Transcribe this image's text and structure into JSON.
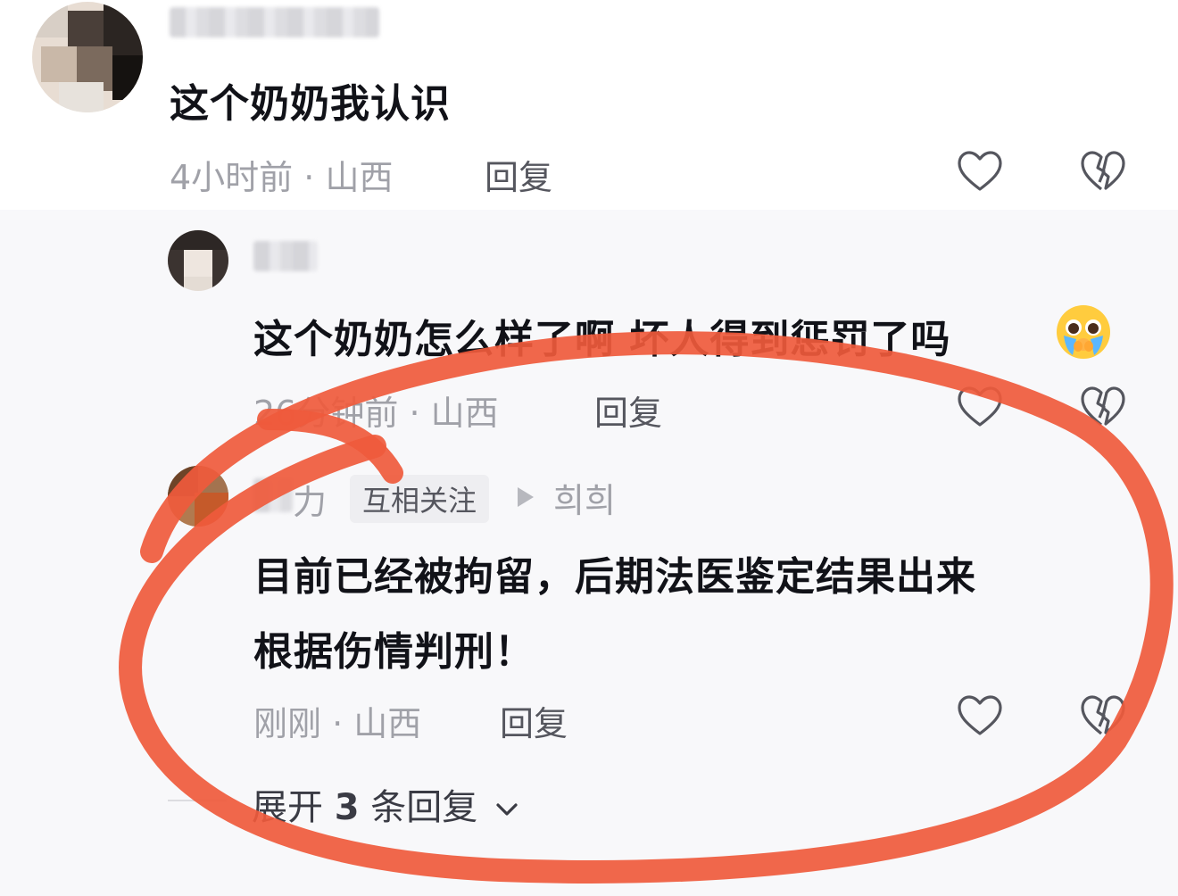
{
  "comments": [
    {
      "text": "这个奶奶我认识",
      "time": "4小时前",
      "location": "山西",
      "reply_label": "回复"
    },
    {
      "text": "这个奶奶怎么样了啊 坏人得到惩罚了吗",
      "emoji": "crying-face-emoji",
      "time": "26分钟前",
      "location": "山西",
      "reply_label": "回复"
    },
    {
      "username": "力",
      "follow_tag": "互相关注",
      "reply_to": "희희",
      "text_line1": "目前已经被拘留，后期法医鉴定结果出来",
      "text_line2": "根据伤情判刑！",
      "time": "刚刚",
      "location": "山西",
      "reply_label": "回复"
    }
  ],
  "expand": {
    "prefix": "展开",
    "count": "3",
    "suffix": "条回复"
  },
  "separator": "·",
  "icons": {
    "like": "heart-outline-icon",
    "dislike": "broken-heart-icon",
    "expand": "chevron-down-icon"
  },
  "colors": {
    "annotation_circle": "#ef5a3c",
    "meta_text": "#a0a1a8",
    "background_reply": "#f8f8fa"
  }
}
